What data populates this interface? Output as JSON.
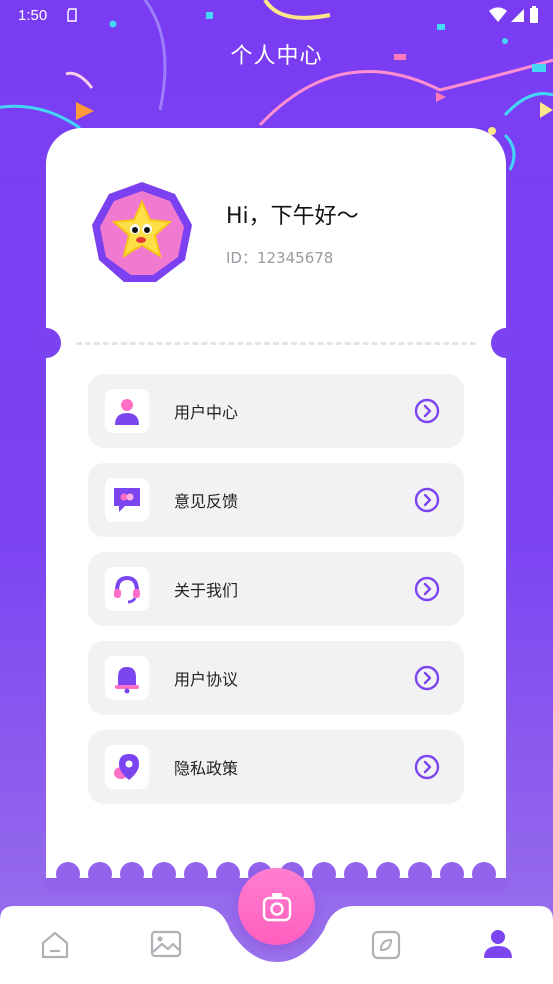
{
  "status_bar": {
    "time": "1:50"
  },
  "header": {
    "title": "个人中心"
  },
  "profile": {
    "greeting": "Hi，下午好～",
    "id_text": "ID：12345678"
  },
  "menu": {
    "items": [
      {
        "label": "用户中心",
        "icon": "user-icon"
      },
      {
        "label": "意见反馈",
        "icon": "feedback-icon"
      },
      {
        "label": "关于我们",
        "icon": "headset-icon"
      },
      {
        "label": "用户协议",
        "icon": "bell-icon"
      },
      {
        "label": "隐私政策",
        "icon": "location-pin-icon"
      }
    ]
  },
  "bottom_nav": {
    "items": [
      "home-icon",
      "gallery-icon",
      "camera-icon",
      "discover-icon",
      "profile-icon"
    ],
    "active": "profile-icon"
  },
  "colors": {
    "primary": "#7a3cf3",
    "accent_pink": "#ff6ec7",
    "arrow": "#7b46f0"
  }
}
